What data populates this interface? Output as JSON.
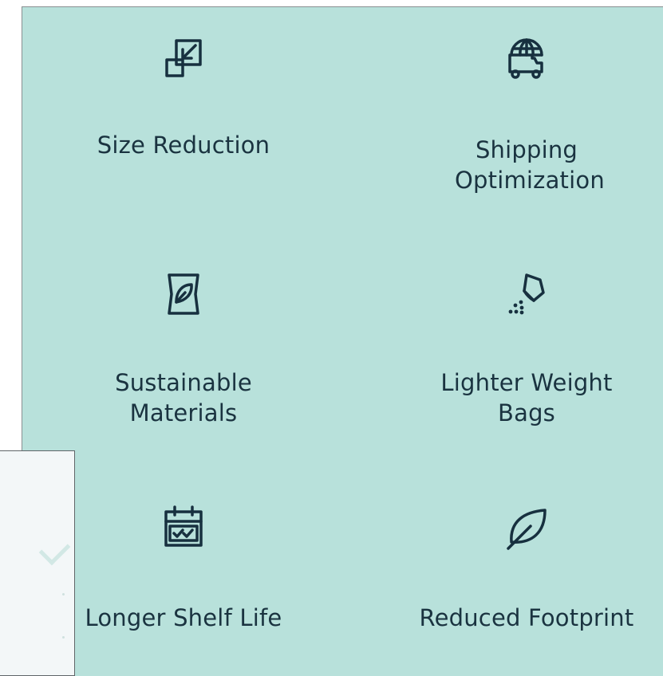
{
  "colors": {
    "panel_background": "#b8e1db",
    "text": "#1a3340",
    "icon_stroke": "#17303f",
    "back_card": "#f3f7f8"
  },
  "features": [
    {
      "label": "Size Reduction",
      "icon": "size-reduction-icon"
    },
    {
      "label": "Shipping Optimization",
      "icon": "globe-truck-icon"
    },
    {
      "label": "Sustainable Materials",
      "icon": "leaf-bag-icon"
    },
    {
      "label": "Lighter Weight Bags",
      "icon": "pouring-bag-icon"
    },
    {
      "label": "Longer Shelf Life",
      "icon": "calendar-check-icon"
    },
    {
      "label": "Reduced Footprint",
      "icon": "leaf-icon"
    }
  ]
}
